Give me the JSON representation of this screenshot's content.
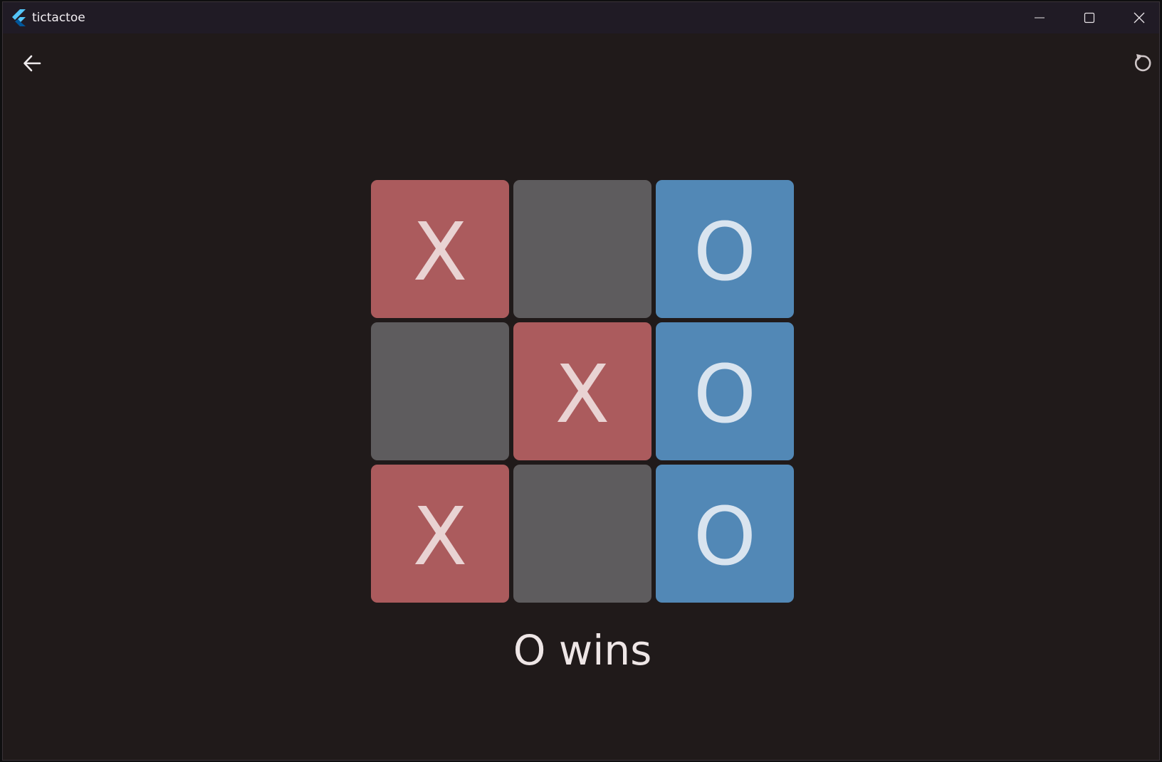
{
  "window": {
    "title": "tictactoe"
  },
  "icons": {
    "app_logo": "flutter-logo-icon",
    "minimize": "minimize-icon",
    "maximize": "maximize-icon",
    "close": "close-icon",
    "back": "arrow-back-icon",
    "restart": "restart-icon"
  },
  "board": {
    "cells": [
      {
        "mark": "X",
        "state": "x"
      },
      {
        "mark": "",
        "state": "empty"
      },
      {
        "mark": "O",
        "state": "o"
      },
      {
        "mark": "",
        "state": "empty"
      },
      {
        "mark": "X",
        "state": "x"
      },
      {
        "mark": "O",
        "state": "o"
      },
      {
        "mark": "X",
        "state": "x"
      },
      {
        "mark": "",
        "state": "empty"
      },
      {
        "mark": "O",
        "state": "o"
      }
    ]
  },
  "status": {
    "text": "O wins"
  },
  "colors": {
    "background": "#201a1a",
    "titlebar": "#201b25",
    "x_tile": "#ab5b5d",
    "o_tile": "#5288b6",
    "empty_tile": "#5e5c5e"
  }
}
